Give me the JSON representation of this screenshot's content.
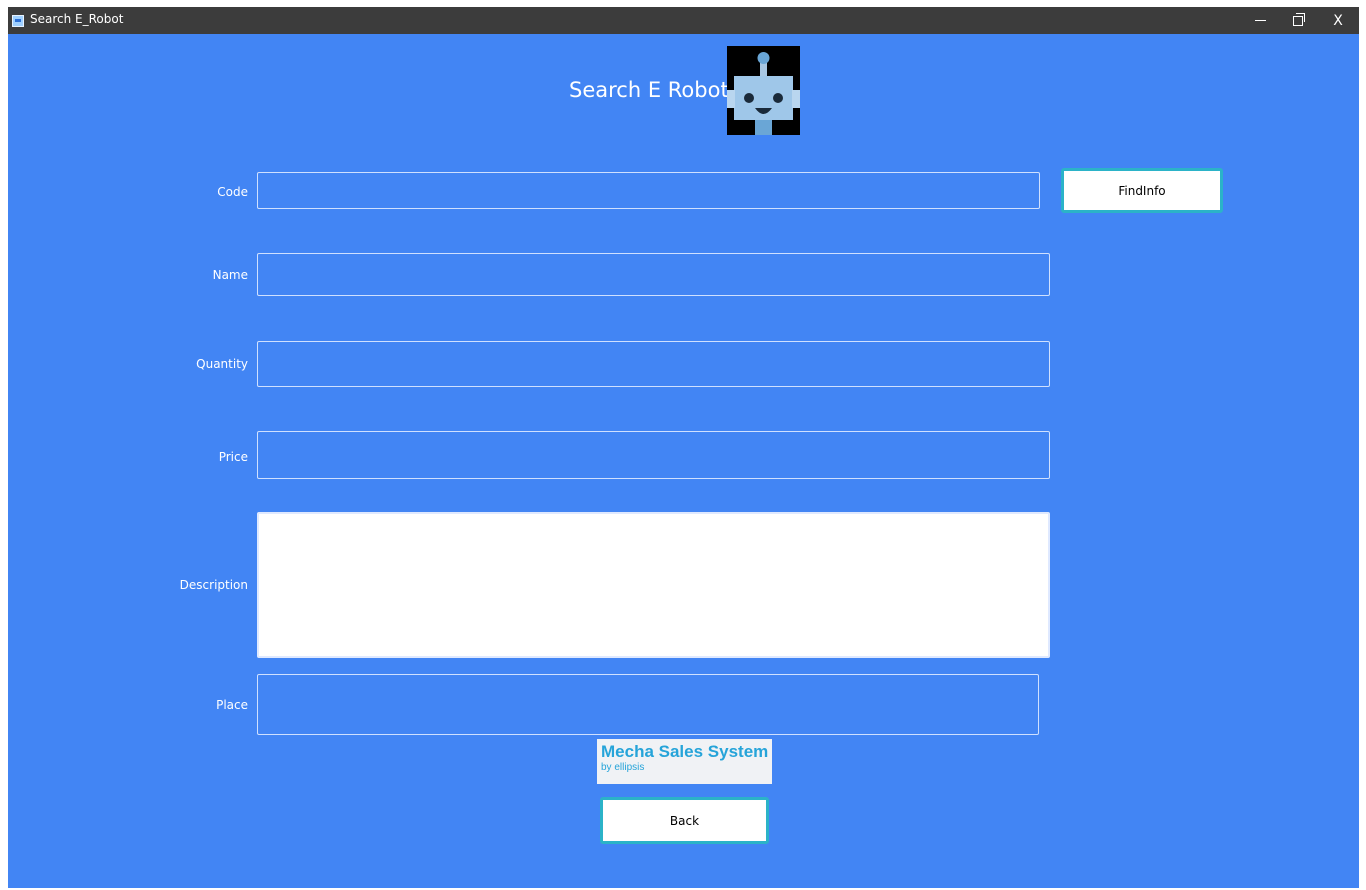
{
  "window": {
    "title": "Search E_Robot",
    "controls": {
      "minimize": "minimize-icon",
      "maximize": "restore-icon",
      "close": "X"
    }
  },
  "header": {
    "title": "Search E Robot",
    "image": "robot-icon"
  },
  "form": {
    "code": {
      "label": "Code",
      "value": ""
    },
    "name": {
      "label": "Name",
      "value": ""
    },
    "quantity": {
      "label": "Quantity",
      "value": ""
    },
    "price": {
      "label": "Price",
      "value": ""
    },
    "description": {
      "label": "Description",
      "value": ""
    },
    "place": {
      "label": "Place",
      "value": ""
    }
  },
  "buttons": {
    "find": "FindInfo",
    "back": "Back"
  },
  "logo": {
    "main": "Mecha Sales System",
    "sub": "by ellipsis"
  },
  "colors": {
    "background": "#4285f4",
    "titlebar": "#3c3c3c",
    "button_border": "#2bb3c8",
    "logo_text": "#26a4d9"
  }
}
